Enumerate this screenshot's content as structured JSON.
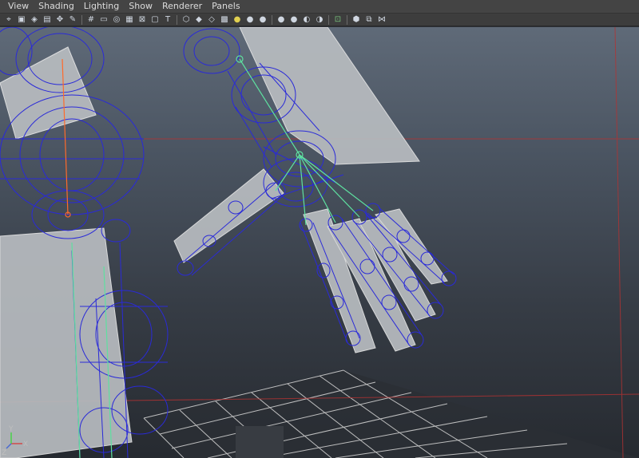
{
  "menu": {
    "items": [
      {
        "label": "View"
      },
      {
        "label": "Shading"
      },
      {
        "label": "Lighting"
      },
      {
        "label": "Show"
      },
      {
        "label": "Renderer"
      },
      {
        "label": "Panels"
      }
    ]
  },
  "toolbar": {
    "groups": [
      [
        "select-camera-icon",
        "camera-attributes-icon",
        "bookmark-icon",
        "image-plane-icon",
        "2d-pan-zoom-icon",
        "grease-pencil-icon"
      ],
      [
        "grid-icon",
        "film-gate-icon",
        "resolution-gate-icon",
        "gate-mask-icon",
        "field-chart-icon",
        "safe-action-icon",
        "safe-title-icon"
      ],
      [
        "wireframe-icon",
        "smooth-shade-icon",
        "wireframe-on-shaded-icon",
        "textured-icon",
        "use-all-lights-icon",
        "shadows-icon",
        "high-quality-icon"
      ],
      [
        "xray-icon",
        "xray-joints-icon",
        "backface-culling-icon",
        "screen-space-ao-icon"
      ],
      [
        "isolate-select-icon",
        "xray-active-components-icon",
        "isolate-view-icon"
      ]
    ],
    "colors": {
      "camera": "#9fb4cc",
      "grid": "#d0d0d0",
      "shading": "#7aa7d8",
      "light": "#e0d050",
      "isolate": "#76c07a"
    }
  },
  "viewport": {
    "wire_color": "#2a2ad8",
    "joint_color": "#5ee0a0",
    "bone_color": "#ff6a2a",
    "proxy_color": "#b8bcc0",
    "grid_color": "#d0d0d0",
    "axis": {
      "x": "X",
      "y": "Y",
      "z": "Z"
    }
  }
}
